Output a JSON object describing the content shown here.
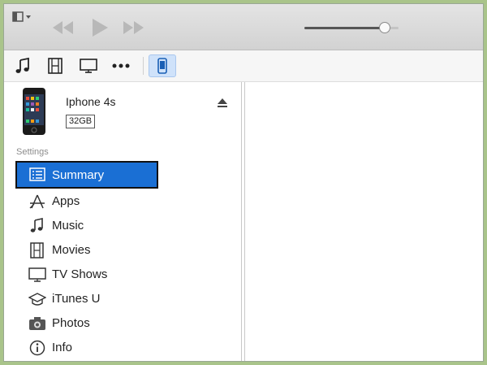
{
  "device": {
    "name": "Iphone 4s",
    "capacity": "32GB"
  },
  "sidebar": {
    "section_label": "Settings",
    "items": [
      {
        "label": "Summary",
        "icon": "summary-icon",
        "active": true
      },
      {
        "label": "Apps",
        "icon": "apps-icon"
      },
      {
        "label": "Music",
        "icon": "music-note-icon"
      },
      {
        "label": "Movies",
        "icon": "film-icon"
      },
      {
        "label": "TV Shows",
        "icon": "tv-icon"
      },
      {
        "label": "iTunes U",
        "icon": "graduation-cap-icon"
      },
      {
        "label": "Photos",
        "icon": "camera-icon"
      },
      {
        "label": "Info",
        "icon": "info-icon"
      }
    ]
  },
  "player": {
    "volume_level": 0.85
  },
  "colors": {
    "selection": "#1a6fd4",
    "device_highlight": "#cfe2fa",
    "background": "#a9c48a"
  }
}
